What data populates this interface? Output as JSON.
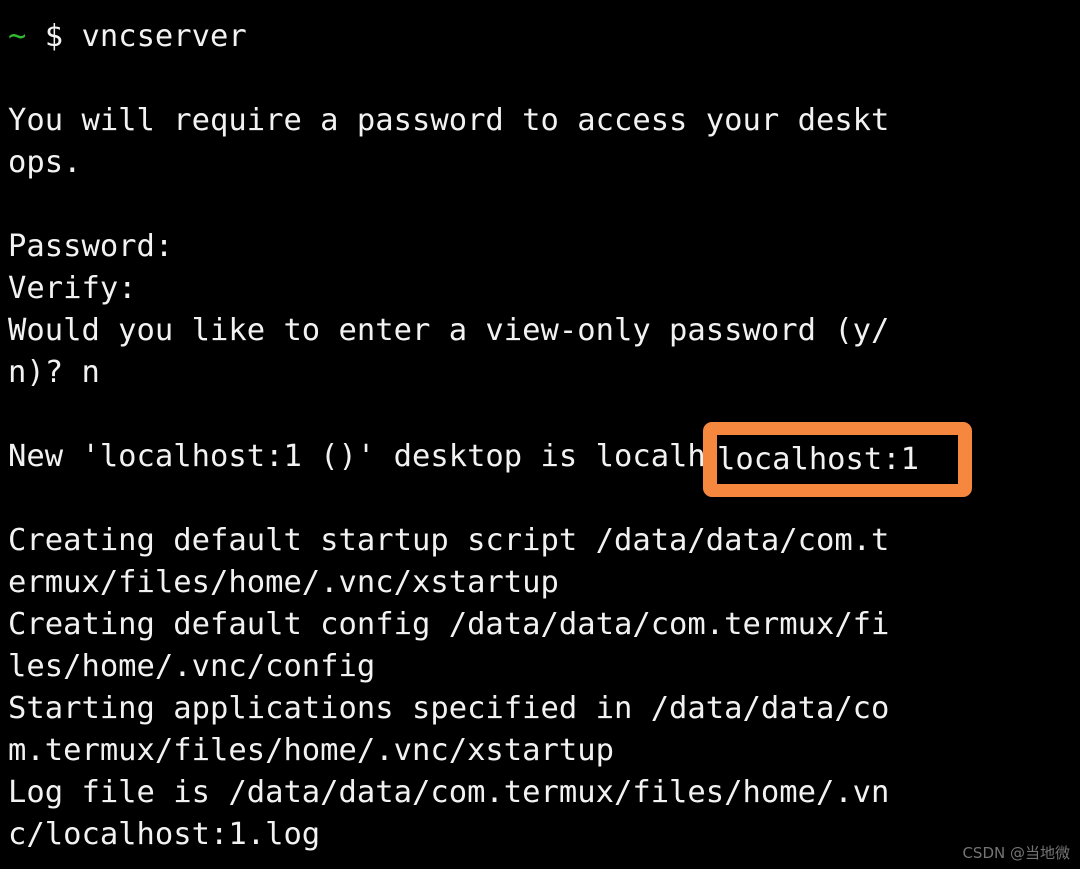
{
  "terminal": {
    "background_color": "#000000",
    "foreground_color": "#f2f2f2",
    "prompt_symbol_color": "#2fbb2f",
    "prompt": {
      "tilde": "~",
      "dollar_and_command": "$ vncserver"
    },
    "lines": [
      {
        "id": "l0",
        "text": "",
        "blank": true
      },
      {
        "id": "l1",
        "text": "You will require a password to access your deskt"
      },
      {
        "id": "l2",
        "text": "ops."
      },
      {
        "id": "l3",
        "text": "",
        "blank": true
      },
      {
        "id": "l4",
        "text": "Password:"
      },
      {
        "id": "l5",
        "text": "Verify:"
      },
      {
        "id": "l6",
        "text": "Would you like to enter a view-only password (y/"
      },
      {
        "id": "l7",
        "text": "n)? n"
      },
      {
        "id": "l8",
        "text": "",
        "blank": true
      },
      {
        "id": "l9",
        "text": "New 'localhost:1 ()' desktop is localhost:1"
      },
      {
        "id": "l10",
        "text": "",
        "blank": true
      },
      {
        "id": "l11",
        "text": "Creating default startup script /data/data/com.t"
      },
      {
        "id": "l12",
        "text": "ermux/files/home/.vnc/xstartup"
      },
      {
        "id": "l13",
        "text": "Creating default config /data/data/com.termux/fi"
      },
      {
        "id": "l14",
        "text": "les/home/.vnc/config"
      },
      {
        "id": "l15",
        "text": "Starting applications specified in /data/data/co"
      },
      {
        "id": "l16",
        "text": "m.termux/files/home/.vnc/xstartup"
      },
      {
        "id": "l17",
        "text": "Log file is /data/data/com.termux/files/home/.vn"
      },
      {
        "id": "l18",
        "text": "c/localhost:1.log"
      }
    ]
  },
  "annotation": {
    "highlight_text": "localhost:1",
    "border_color": "#f5873e",
    "fill_color": "#000000"
  },
  "watermark": {
    "text": "CSDN @当地微",
    "color": "#8a8a8a"
  }
}
